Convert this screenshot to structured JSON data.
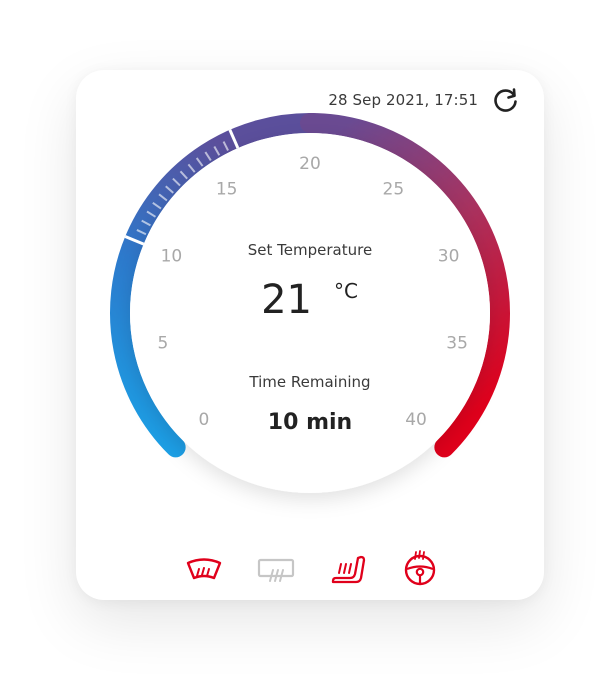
{
  "header": {
    "timestamp": "28 Sep 2021, 17:51",
    "refresh_icon": "refresh-icon"
  },
  "dial": {
    "label_set": "Set Temperature",
    "value": "21",
    "unit": "°C",
    "label_time": "Time Remaining",
    "time_value": "10 min",
    "min": 0,
    "max": 40,
    "current_temperature": 21,
    "ticks": [
      "0",
      "5",
      "10",
      "15",
      "20",
      "25",
      "30",
      "35",
      "40"
    ],
    "colors": {
      "cold": "#1aa3e8",
      "mid": "#5b4f9c",
      "hot": "#e0001b"
    }
  },
  "controls": [
    {
      "name": "windshield-defrost",
      "icon": "windshield-heat-icon",
      "active": true
    },
    {
      "name": "rear-window-defrost",
      "icon": "rear-window-heat-icon",
      "active": false
    },
    {
      "name": "seat-heating",
      "icon": "seat-heat-icon",
      "active": true
    },
    {
      "name": "steering-wheel-heating",
      "icon": "steering-wheel-heat-icon",
      "active": true
    }
  ]
}
